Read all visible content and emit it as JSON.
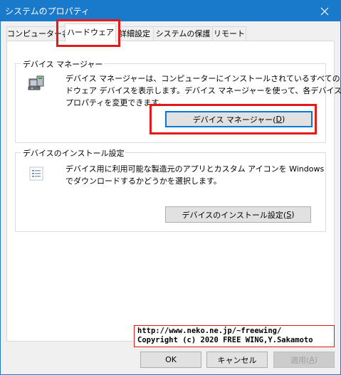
{
  "window": {
    "title": "システムのプロパティ"
  },
  "tabs": [
    {
      "label": "コンピューター名"
    },
    {
      "label": "ハードウェア"
    },
    {
      "label": "詳細設定"
    },
    {
      "label": "システムの保護"
    },
    {
      "label": "リモート"
    }
  ],
  "active_tab": "ハードウェア",
  "device_manager": {
    "group_label": "デバイス マネージャー",
    "description_line1": "デバイス マネージャーは、コンピューターにインストールされているすべてのハー",
    "description_line2": "ドウェア デバイスを表示します。デバイス マネージャーを使って、各デバイスの",
    "description_line3": "プロパティを変更できます。",
    "button_label": "デバイス マネージャー(",
    "button_accel": "D",
    "button_suffix": ")",
    "icon": "device-manager-icon"
  },
  "install_settings": {
    "group_label": "デバイスのインストール設定",
    "description_line1": "デバイス用に利用可能な製造元のアプリとカスタム アイコンを Windows",
    "description_line2": "でダウンロードするかどうかを選択します。",
    "button_label": "デバイスのインストール設定(",
    "button_accel": "S",
    "button_suffix": ")",
    "icon": "settings-list-icon"
  },
  "footer": {
    "ok_label": "OK",
    "cancel_label": "キャンセル",
    "apply_label": "適用(",
    "apply_accel": "A",
    "apply_suffix": ")"
  },
  "watermark": {
    "line1": "http://www.neko.ne.jp/~freewing/",
    "line2": "Copyright (c) 2020 FREE WING,Y.Sakamoto"
  },
  "colors": {
    "titlebar": "#1979ca",
    "highlight": "#e21a1a",
    "focus": "#0078d7"
  }
}
